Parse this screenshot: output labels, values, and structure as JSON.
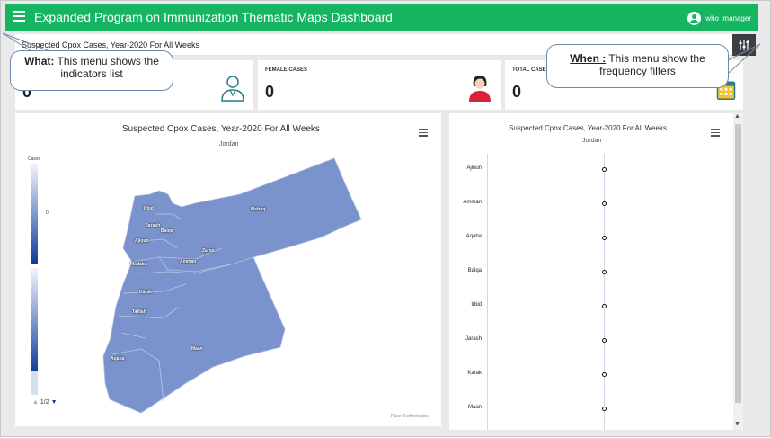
{
  "app": {
    "title": "Expanded Program on Immunization Thematic Maps Dashboard",
    "user": "who_manager",
    "brand_color": "#16b561"
  },
  "breadcrumb": "Suspected Cpox Cases, Year-2020 For All Weeks",
  "kpis": [
    {
      "label": "",
      "value": "0",
      "icon": "male-person-icon"
    },
    {
      "label": "FEMALE CASES",
      "value": "0",
      "icon": "female-person-icon"
    },
    {
      "label": "TOTAL CASES",
      "value": "0",
      "icon": "calendar-icon"
    }
  ],
  "map_panel": {
    "title": "Suspected Cpox Cases, Year-2020 For All Weeks",
    "subtitle": "Jordan",
    "legend_top_label": "Cases",
    "legend_mid_label": "0",
    "pager": "1/2",
    "credits": "Pace Technologies",
    "region_color": "#7b93cc",
    "governorates": [
      "Irbid",
      "Mafraq",
      "Jarash",
      "Ajloun",
      "Balqa",
      "Zarqa",
      "Amman",
      "Madaba",
      "Karak",
      "Tafilah",
      "Maan",
      "Aqaba"
    ]
  },
  "chart_panel": {
    "title": "Suspected Cpox Cases, Year-2020 For All Weeks",
    "subtitle": "Jordan"
  },
  "chart_data": {
    "type": "scatter",
    "title": "Suspected Cpox Cases, Year-2020 For All Weeks",
    "subtitle": "Jordan",
    "categories": [
      "Ajloun",
      "Amman",
      "Aqaba",
      "Balqa",
      "Irbid",
      "Jarash",
      "Karak",
      "Maan"
    ],
    "values": [
      0,
      0,
      0,
      0,
      0,
      0,
      0,
      0
    ]
  },
  "callouts": {
    "what_label": "What:",
    "what_text": " This menu shows the indicators list",
    "when_label": "When :",
    "when_text": " This menu show the frequency filters"
  },
  "filter_button_icon": "sliders-icon"
}
